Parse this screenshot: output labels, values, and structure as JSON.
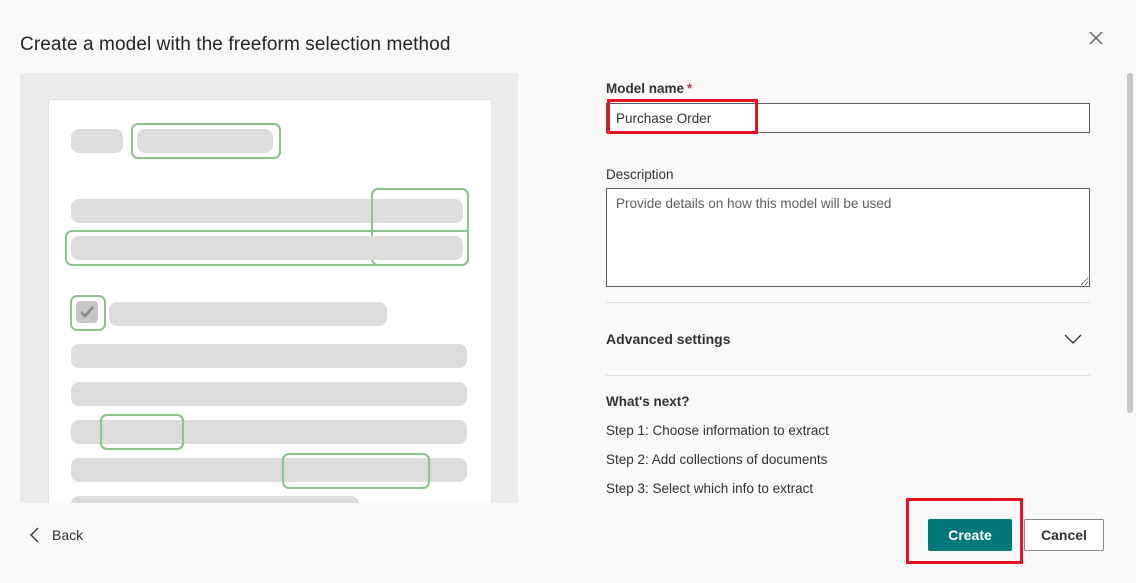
{
  "dialog": {
    "title": "Create a model with the freeform selection method"
  },
  "form": {
    "model_name_label": "Model name",
    "required_mark": "*",
    "model_name_value": "Purchase Order",
    "description_label": "Description",
    "description_placeholder": "Provide details on how this model will be used",
    "advanced_settings_label": "Advanced settings"
  },
  "whats_next": {
    "title": "What's next?",
    "steps": [
      "Step 1: Choose information to extract",
      "Step 2: Add collections of documents",
      "Step 3: Select which info to extract"
    ]
  },
  "footer": {
    "back_label": "Back",
    "create_label": "Create",
    "cancel_label": "Cancel"
  },
  "icons": {
    "close": "close-icon",
    "back": "chevron-left-icon",
    "expand": "chevron-down-icon",
    "check": "checkmark-icon"
  },
  "colors": {
    "primary": "#03787c",
    "highlight": "#e81123",
    "selection": "#8cc28c"
  }
}
